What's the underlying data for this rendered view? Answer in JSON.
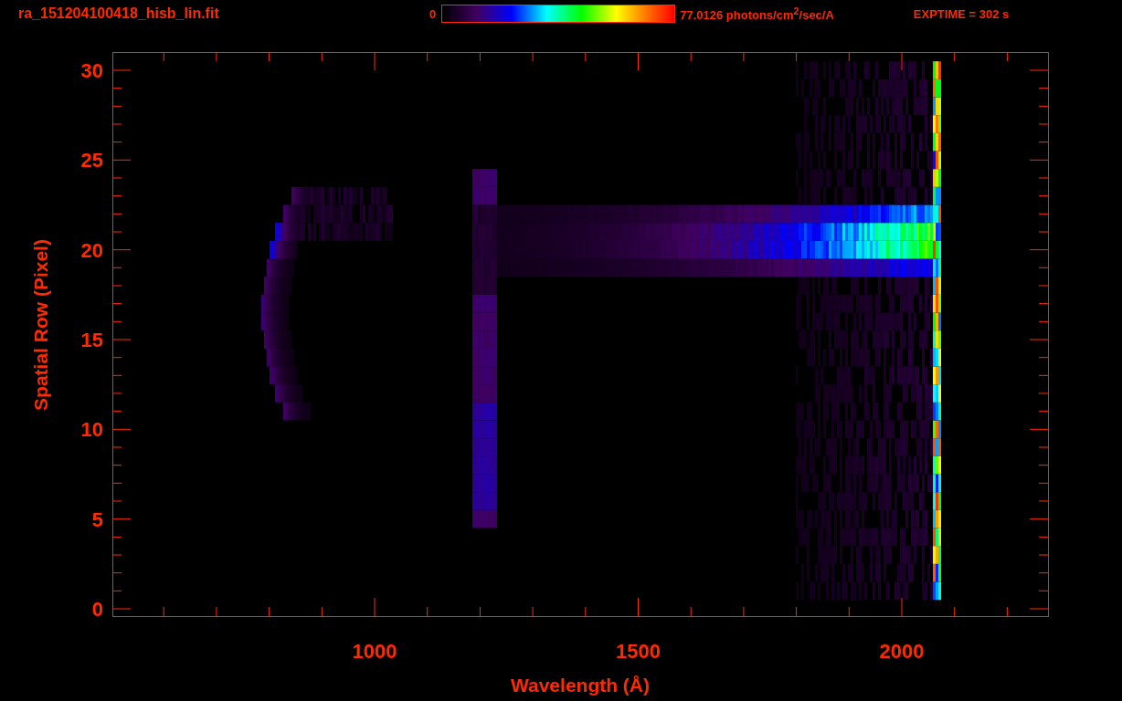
{
  "header": {
    "file_name": "ra_151204100418_hisb_lin.fit",
    "colorbar": {
      "min_label": "0",
      "max_label": "77.0126 photons/cm$^{2}$/sec/A"
    },
    "exposure": "EXPTIME = 302 s"
  },
  "plot": {
    "xlabel": "Wavelength (Å)",
    "ylabel": "Spatial Row (Pixel)",
    "xtick_labels": [
      "1000",
      "1500",
      "2000"
    ],
    "ytick_labels": [
      "30",
      "25",
      "20",
      "15",
      "10",
      "5",
      "0"
    ]
  }
}
